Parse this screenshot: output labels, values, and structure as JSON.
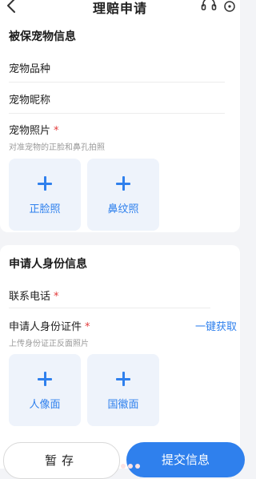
{
  "header": {
    "title": "理赔申请",
    "back_icon": "chevron-left-icon",
    "service_icon": "headset-icon",
    "more_icon": "more-icon"
  },
  "pet_section": {
    "title": "被保宠物信息",
    "breed_label": "宠物品种",
    "nickname_label": "宠物昵称",
    "photo_label": "宠物照片",
    "photo_required": "*",
    "photo_hint": "对准宠物的正脸和鼻孔拍照",
    "uploads": [
      {
        "label": "正脸照"
      },
      {
        "label": "鼻纹照"
      }
    ]
  },
  "applicant_section": {
    "title": "申请人身份信息",
    "phone_label": "联系电话",
    "phone_required": "*",
    "id_label": "申请人身份证件",
    "id_required": "*",
    "quick_fill_link": "一键获取",
    "id_hint": "上传身份证正反面照片",
    "uploads": [
      {
        "label": "人像面"
      },
      {
        "label": "国徽面"
      }
    ]
  },
  "footer": {
    "save_label": "暂存",
    "submit_label": "提交信息"
  },
  "colors": {
    "accent": "#2f80ed",
    "required": "#e23b3b",
    "upload_bg": "#eef3fb"
  }
}
